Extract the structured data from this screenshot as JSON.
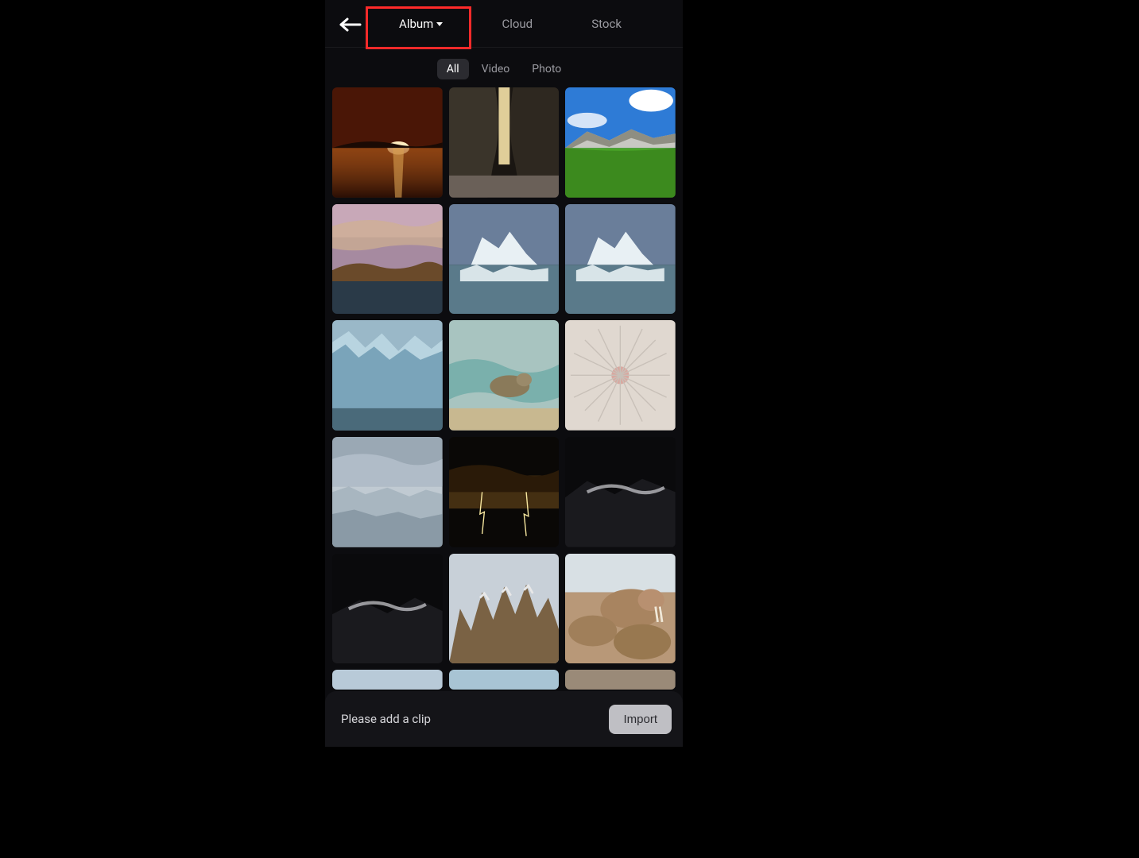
{
  "header": {
    "tabs": [
      "Album",
      "Cloud",
      "Stock"
    ],
    "active_tab": "Album"
  },
  "filters": {
    "items": [
      "All",
      "Video",
      "Photo"
    ],
    "active": "All"
  },
  "thumbnails": [
    {
      "name": "sunset-over-water"
    },
    {
      "name": "canyon-light"
    },
    {
      "name": "green-meadow-mountain"
    },
    {
      "name": "coast-sunset-pano"
    },
    {
      "name": "iceberg-sea-1"
    },
    {
      "name": "iceberg-sea-2"
    },
    {
      "name": "glacier-wall"
    },
    {
      "name": "seal-in-waves"
    },
    {
      "name": "dandelion-closeup"
    },
    {
      "name": "ice-field-cloudy"
    },
    {
      "name": "lightning-storm"
    },
    {
      "name": "dark-mountain-clouds-1"
    },
    {
      "name": "dark-mountain-clouds-2"
    },
    {
      "name": "rocky-peaks"
    },
    {
      "name": "walrus-group"
    },
    {
      "name": "partial-1"
    },
    {
      "name": "partial-2"
    },
    {
      "name": "partial-3"
    }
  ],
  "bottom": {
    "prompt": "Please add a clip",
    "import_label": "Import"
  },
  "annotation": {
    "highlight": "album-tab"
  }
}
